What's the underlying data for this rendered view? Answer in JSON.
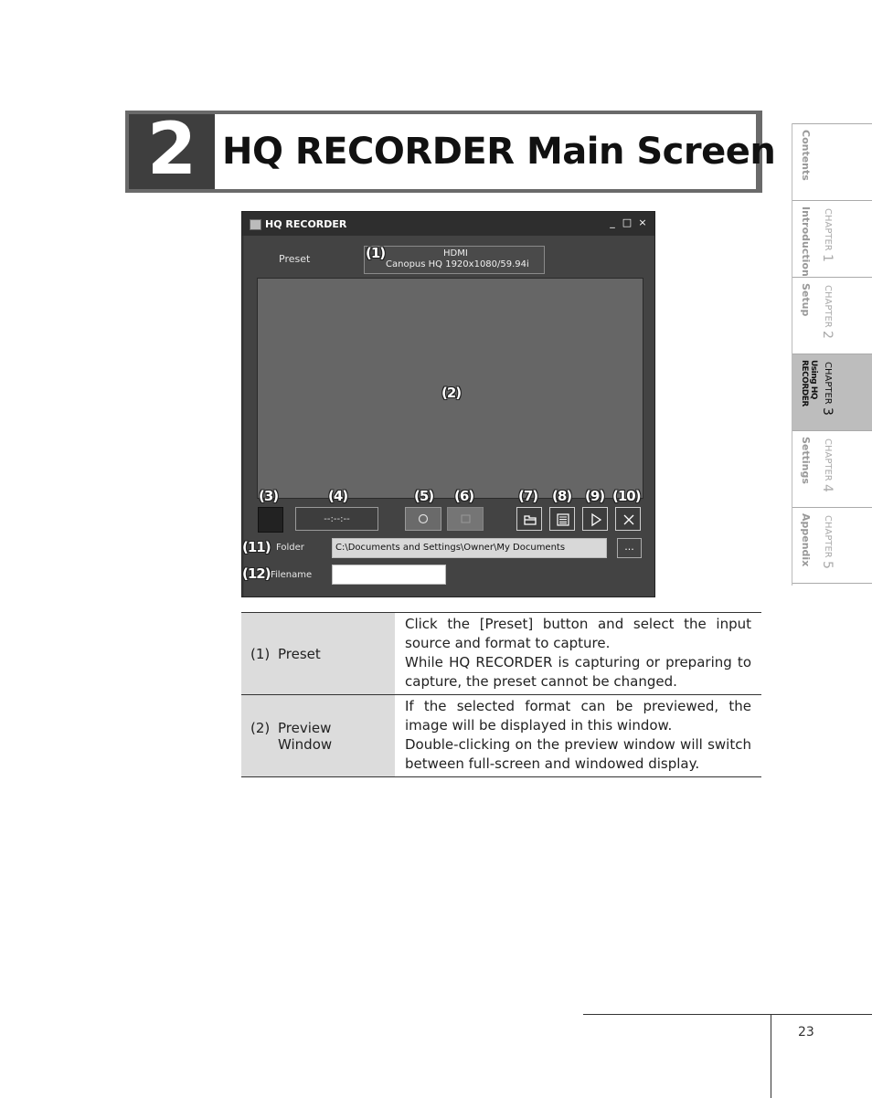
{
  "heading": {
    "number": "2",
    "title": "HQ RECORDER Main Screen"
  },
  "side_tabs": [
    {
      "label": "Contents",
      "chapter": ""
    },
    {
      "label": "Introduction",
      "chapter": "CHAPTER",
      "num": "1"
    },
    {
      "label": "Setup",
      "chapter": "CHAPTER",
      "num": "2"
    },
    {
      "label": "Using HQ RECORDER",
      "chapter": "CHAPTER",
      "num": "3"
    },
    {
      "label": "Settings",
      "chapter": "CHAPTER",
      "num": "4"
    },
    {
      "label": "Appendix",
      "chapter": "CHAPTER",
      "num": "5"
    }
  ],
  "window": {
    "title": "HQ RECORDER",
    "preset_label": "Preset",
    "preset_line1": "HDMI",
    "preset_line2": "Canopus HQ 1920x1080/59.94i",
    "timecode": "--:--:--",
    "folder_label": "Folder",
    "folder_value": "C:\\Documents and Settings\\Owner\\My Documents",
    "browse_label": "...",
    "filename_label": "Filename",
    "filename_value": ""
  },
  "callouts": {
    "c1": "(1)",
    "c2": "(2)",
    "c3": "(3)",
    "c4": "(4)",
    "c5": "(5)",
    "c6": "(6)",
    "c7": "(7)",
    "c8": "(8)",
    "c9": "(9)",
    "c10": "(10)",
    "c11": "(11)",
    "c12": "(12)"
  },
  "table": [
    {
      "num": "(1)",
      "name1": "Preset",
      "name2": "",
      "desc": [
        "Click the [Preset] button and select the input source and format to capture.",
        "While HQ RECORDER is capturing or preparing to capture, the preset cannot be changed."
      ]
    },
    {
      "num": "(2)",
      "name1": "Preview",
      "name2": "Window",
      "desc": [
        "If the selected format can be previewed, the image will be displayed in this window.",
        "Double-clicking on the preview window will switch between full-screen and windowed display."
      ]
    }
  ],
  "page_number": "23"
}
